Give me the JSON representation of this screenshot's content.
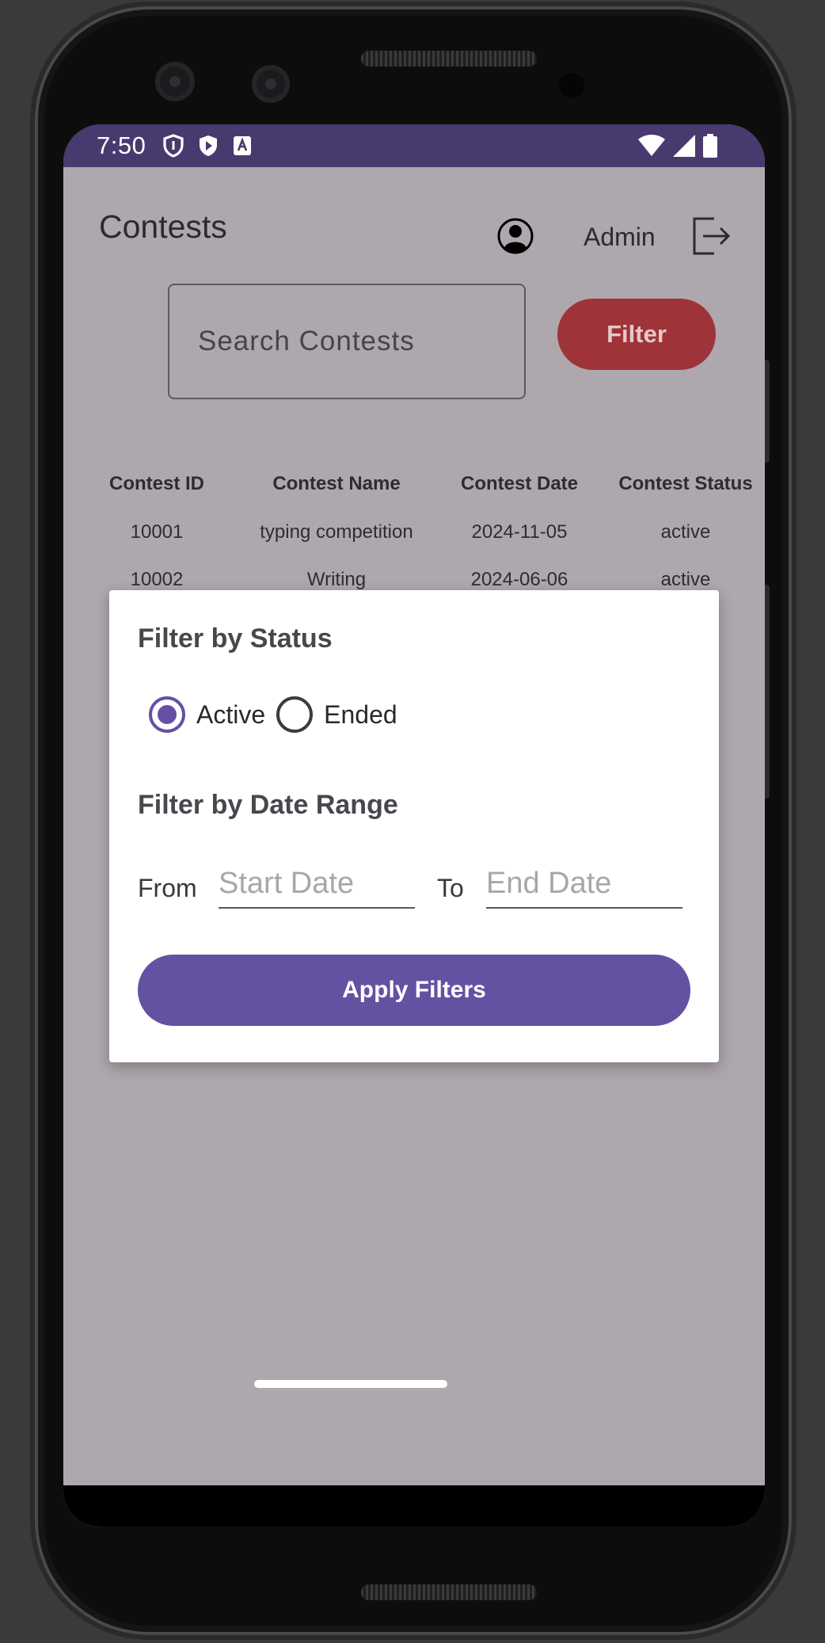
{
  "status_bar": {
    "time": "7:50"
  },
  "header": {
    "title": "Contests",
    "user_name": "Admin"
  },
  "search": {
    "placeholder": "Search Contests"
  },
  "toolbar": {
    "filter_label": "Filter"
  },
  "table": {
    "columns": [
      "Contest ID",
      "Contest Name",
      "Contest Date",
      "Contest Status"
    ],
    "rows": [
      [
        "10001",
        "typing competition",
        "2024-11-05",
        "active"
      ],
      [
        "10002",
        "Writing",
        "2024-06-06",
        "active"
      ]
    ]
  },
  "dialog": {
    "status_heading": "Filter by Status",
    "status_options": [
      {
        "label": "Active",
        "checked": true
      },
      {
        "label": "Ended",
        "checked": false
      }
    ],
    "date_heading": "Filter by Date Range",
    "from_label": "From",
    "start_placeholder": "Start Date",
    "to_label": "To",
    "end_placeholder": "End Date",
    "apply_label": "Apply Filters"
  },
  "colors": {
    "status_bar": "#483a6e",
    "filter_button": "#9e3439",
    "apply_button": "#6451a2",
    "radio_accent": "#6650a4",
    "scrim": "#aea8ae"
  }
}
